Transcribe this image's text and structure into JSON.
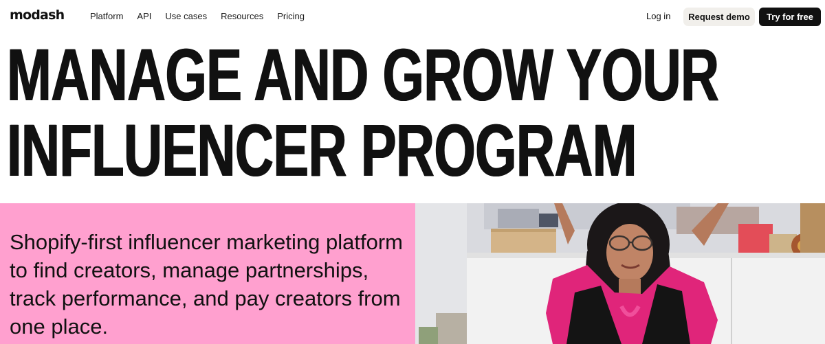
{
  "brand": {
    "logo_text": "modash"
  },
  "nav": {
    "items": [
      {
        "label": "Platform"
      },
      {
        "label": "API"
      },
      {
        "label": "Use cases"
      },
      {
        "label": "Resources"
      },
      {
        "label": "Pricing"
      }
    ],
    "login_label": "Log in",
    "demo_label": "Request demo",
    "try_label": "Try for free"
  },
  "hero": {
    "headline_lines": [
      "MANAGE AND GROW YOUR",
      "INFLUENCER PROGRAM"
    ],
    "description": "Shopify-first influencer marketing platform to find creators, manage partnerships, track performance, and pay creators from one place.",
    "panel_color": "#ffa0cf"
  },
  "colors": {
    "primary_button": "#111111",
    "secondary_button": "#f1efeb",
    "text": "#111111"
  }
}
